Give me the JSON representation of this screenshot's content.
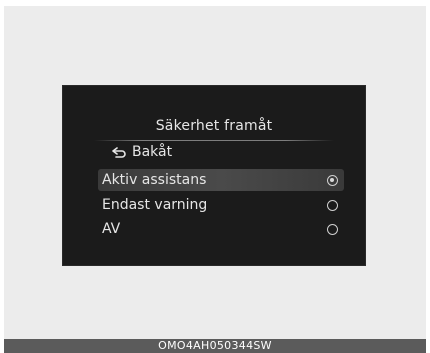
{
  "screen": {
    "title": "Säkerhet framåt",
    "back_label": "Bakåt",
    "options": [
      {
        "label": "Aktiv assistans",
        "selected": true
      },
      {
        "label": "Endast varning",
        "selected": false
      },
      {
        "label": "AV",
        "selected": false
      }
    ]
  },
  "footer": {
    "code": "OMO4AH050344SW"
  }
}
